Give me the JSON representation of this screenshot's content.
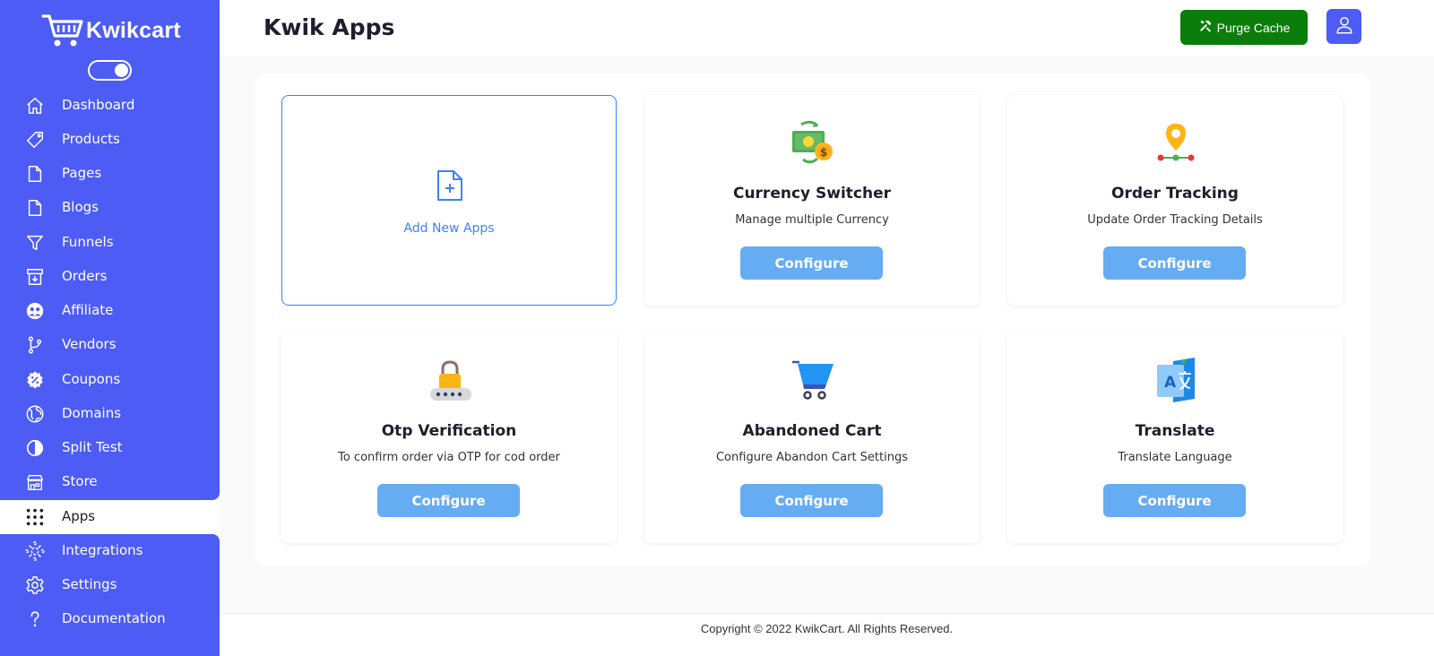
{
  "brand": {
    "name": "Kwikcart"
  },
  "sidebar": {
    "items": [
      {
        "label": "Dashboard",
        "icon": "home-icon"
      },
      {
        "label": "Products",
        "icon": "tag-icon"
      },
      {
        "label": "Pages",
        "icon": "file-icon"
      },
      {
        "label": "Blogs",
        "icon": "file-icon"
      },
      {
        "label": "Funnels",
        "icon": "funnel-icon"
      },
      {
        "label": "Orders",
        "icon": "archive-icon"
      },
      {
        "label": "Affiliate",
        "icon": "affiliate-icon"
      },
      {
        "label": "Vendors",
        "icon": "branch-icon"
      },
      {
        "label": "Coupons",
        "icon": "coupon-icon"
      },
      {
        "label": "Domains",
        "icon": "globe-icon"
      },
      {
        "label": "Split Test",
        "icon": "split-circle-icon"
      },
      {
        "label": "Store",
        "icon": "store-icon"
      },
      {
        "label": "Apps",
        "icon": "grid-dots-icon"
      },
      {
        "label": "Integrations",
        "icon": "integrations-icon"
      },
      {
        "label": "Settings",
        "icon": "gear-icon"
      },
      {
        "label": "Documentation",
        "icon": "question-icon"
      }
    ],
    "active": "Apps"
  },
  "header": {
    "title": "Kwik Apps",
    "purge_label": "Purge Cache"
  },
  "apps": {
    "add_label": "Add New Apps",
    "cards": [
      {
        "title": "Currency Switcher",
        "description": "Manage multiple Currency",
        "button": "Configure",
        "icon": "currency-icon"
      },
      {
        "title": "Order Tracking",
        "description": "Update Order Tracking Details",
        "button": "Configure",
        "icon": "location-pin-icon"
      },
      {
        "title": "Otp Verification",
        "description": "To confirm order via OTP for cod order",
        "button": "Configure",
        "icon": "lock-icon"
      },
      {
        "title": "Abandoned Cart",
        "description": "Configure Abandon Cart Settings",
        "button": "Configure",
        "icon": "cart-icon"
      },
      {
        "title": "Translate",
        "description": "Translate Language",
        "button": "Configure",
        "icon": "translate-icon"
      }
    ]
  },
  "footer": {
    "copyright": "Copyright © 2022 KwikCart. All Rights Reserved."
  },
  "colors": {
    "sidebar": "#4c5cf5",
    "purge": "#0a7d0a",
    "configure": "#66acf2",
    "accent": "#3b82f6"
  }
}
